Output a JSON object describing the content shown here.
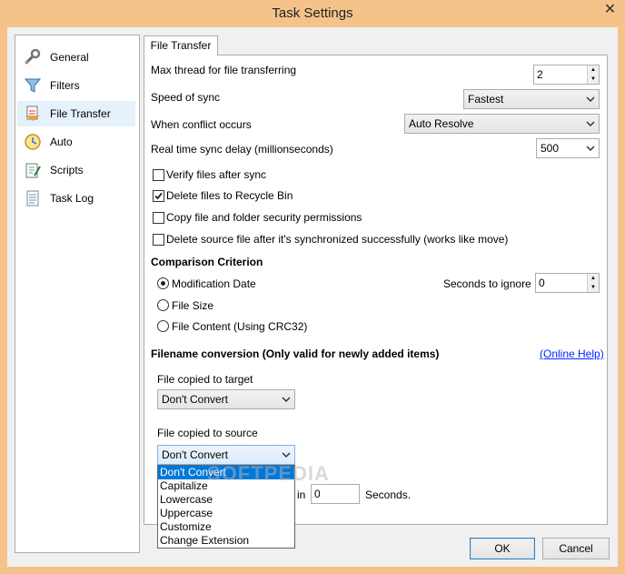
{
  "window": {
    "title": "Task Settings",
    "close_glyph": "✕"
  },
  "sidebar": {
    "items": [
      {
        "label": "General",
        "icon": "wrench-icon"
      },
      {
        "label": "Filters",
        "icon": "funnel-icon"
      },
      {
        "label": "File Transfer",
        "icon": "file-transfer-icon",
        "selected": true
      },
      {
        "label": "Auto",
        "icon": "clock-icon"
      },
      {
        "label": "Scripts",
        "icon": "script-icon"
      },
      {
        "label": "Task Log",
        "icon": "log-icon"
      }
    ]
  },
  "tab": {
    "label": "File Transfer"
  },
  "settings": {
    "max_thread_label": "Max thread for file transferring",
    "max_thread_value": "2",
    "speed_label": "Speed of sync",
    "speed_value": "Fastest",
    "conflict_label": "When conflict occurs",
    "conflict_value": "Auto Resolve",
    "delay_label": "Real time sync delay (millionseconds)",
    "delay_value": "500"
  },
  "checkboxes": [
    {
      "label": "Verify files after sync",
      "checked": false
    },
    {
      "label": "Delete files to Recycle Bin",
      "checked": true
    },
    {
      "label": "Copy file and folder security permissions",
      "checked": false
    },
    {
      "label": "Delete source file after it's synchronized successfully (works like move)",
      "checked": false
    }
  ],
  "comparison": {
    "heading": "Comparison Criterion",
    "options": [
      {
        "label": "Modification Date",
        "selected": true
      },
      {
        "label": "File Size",
        "selected": false
      },
      {
        "label": "File Content (Using CRC32)",
        "selected": false
      }
    ],
    "seconds_label": "Seconds to ignore",
    "seconds_value": "0"
  },
  "filename": {
    "heading": "Filename conversion (Only valid for newly added items)",
    "help_link": "(Online Help)",
    "target_label": "File copied to target",
    "target_value": "Don't Convert",
    "source_label": "File copied to source",
    "source_value": "Don't Convert",
    "options": [
      "Don't Convert",
      "Capitalize",
      "Lowercase",
      "Uppercase",
      "Customize",
      "Change Extension"
    ],
    "partial_label": "in",
    "partial_value": "0",
    "seconds_suffix": "Seconds."
  },
  "watermark": "SOFTPEDIA",
  "buttons": {
    "ok": "OK",
    "cancel": "Cancel"
  },
  "colors": {
    "titlebar": "#f5c38a",
    "selection": "#0078d7",
    "link": "#0026ff"
  }
}
